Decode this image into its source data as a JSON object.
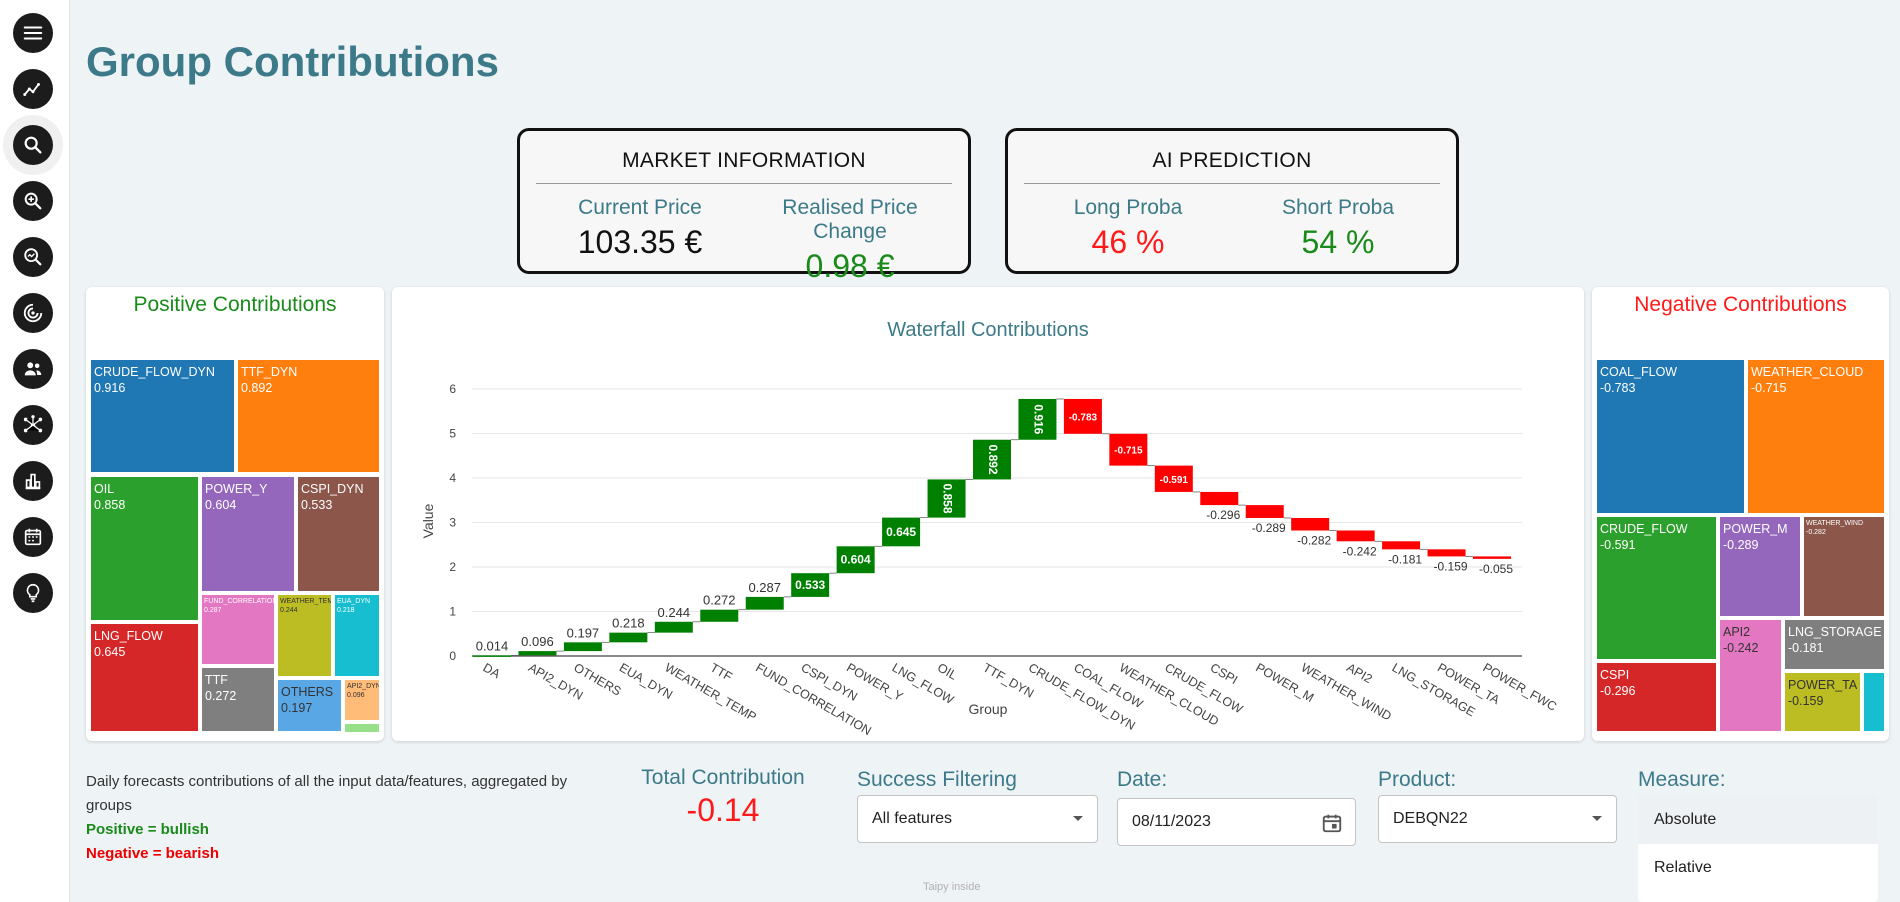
{
  "page": {
    "title": "Group Contributions",
    "footer": "Taipy inside"
  },
  "nav": [
    {
      "name": "menu-icon"
    },
    {
      "name": "trend-icon"
    },
    {
      "name": "search-icon"
    },
    {
      "name": "zoom-in-icon"
    },
    {
      "name": "analytics-search-icon"
    },
    {
      "name": "target-icon"
    },
    {
      "name": "users-icon"
    },
    {
      "name": "network-icon"
    },
    {
      "name": "bar-chart-icon"
    },
    {
      "name": "calendar-icon"
    },
    {
      "name": "lightbulb-icon"
    }
  ],
  "market": {
    "title": "MARKET INFORMATION",
    "current_label": "Current Price",
    "current_value": "103.35 €",
    "change_label": "Realised Price Change",
    "change_value": "0.98 €"
  },
  "ai": {
    "title": "AI PREDICTION",
    "long_label": "Long Proba",
    "long_value": "46 %",
    "short_label": "Short Proba",
    "short_value": "54 %"
  },
  "colors": {
    "positive": "#1a8a1a",
    "negative": "#ff1a1a",
    "accent": "#3c7a89",
    "green_bar": "#008000",
    "red_bar": "#ff0000"
  },
  "positive_panel": {
    "title": "Positive Contributions",
    "tiles": [
      {
        "label": "CRUDE_FLOW_DYN",
        "value": "0.916",
        "color": "#1f77b4"
      },
      {
        "label": "TTF_DYN",
        "value": "0.892",
        "color": "#ff7f0e"
      },
      {
        "label": "OIL",
        "value": "0.858",
        "color": "#2ca02c"
      },
      {
        "label": "POWER_Y",
        "value": "0.604",
        "color": "#9467bd"
      },
      {
        "label": "CSPI_DYN",
        "value": "0.533",
        "color": "#8c564b"
      },
      {
        "label": "LNG_FLOW",
        "value": "0.645",
        "color": "#d62728"
      },
      {
        "label": "FUND_CORRELATION",
        "value": "0.287",
        "color": "#e377c2"
      },
      {
        "label": "WEATHER_TEMP",
        "value": "0.244",
        "color": "#bcbd22"
      },
      {
        "label": "EUA_DYN",
        "value": "0.218",
        "color": "#17becf"
      },
      {
        "label": "TTF",
        "value": "0.272",
        "color": "#7f7f7f"
      },
      {
        "label": "OTHERS",
        "value": "0.197",
        "color": "#5aa7e6"
      },
      {
        "label": "API2_DYN",
        "value": "0.096",
        "color": "#ffbb78"
      },
      {
        "label": "DA",
        "value": "0.014",
        "color": "#98df8a"
      }
    ]
  },
  "negative_panel": {
    "title": "Negative Contributions",
    "tiles": [
      {
        "label": "COAL_FLOW",
        "value": "-0.783",
        "color": "#1f77b4"
      },
      {
        "label": "WEATHER_CLOUD",
        "value": "-0.715",
        "color": "#ff7f0e"
      },
      {
        "label": "CRUDE_FLOW",
        "value": "-0.591",
        "color": "#2ca02c"
      },
      {
        "label": "POWER_M",
        "value": "-0.289",
        "color": "#9467bd"
      },
      {
        "label": "WEATHER_WIND",
        "value": "-0.282",
        "color": "#8c564b"
      },
      {
        "label": "CSPI",
        "value": "-0.296",
        "color": "#d62728"
      },
      {
        "label": "API2",
        "value": "-0.242",
        "color": "#e377c2"
      },
      {
        "label": "LNG_STORAGE",
        "value": "-0.181",
        "color": "#7f7f7f"
      },
      {
        "label": "POWER_TA",
        "value": "-0.159",
        "color": "#bcbd22"
      },
      {
        "label": "POWER_FWC",
        "value": "-0.055",
        "color": "#17becf"
      }
    ]
  },
  "chart_data": {
    "type": "bar",
    "title": "Waterfall Contributions",
    "xlabel": "Group",
    "ylabel": "Value",
    "ylim": [
      0,
      6.3
    ],
    "yticks": [
      0,
      1,
      2,
      3,
      4,
      5,
      6
    ],
    "categories": [
      "DA",
      "API2_DYN",
      "OTHERS",
      "EUA_DYN",
      "WEATHER_TEMP",
      "TTF",
      "FUND_CORRELATION",
      "CSPI_DYN",
      "POWER_Y",
      "LNG_FLOW",
      "OIL",
      "TTF_DYN",
      "CRUDE_FLOW_DYN",
      "COAL_FLOW",
      "WEATHER_CLOUD",
      "CRUDE_FLOW",
      "CSPI",
      "POWER_M",
      "WEATHER_WIND",
      "API2",
      "LNG_STORAGE",
      "POWER_TA",
      "POWER_FWC"
    ],
    "values": [
      0.014,
      0.096,
      0.197,
      0.218,
      0.244,
      0.272,
      0.287,
      0.533,
      0.604,
      0.645,
      0.858,
      0.892,
      0.916,
      -0.783,
      -0.715,
      -0.591,
      -0.296,
      -0.289,
      -0.282,
      -0.242,
      -0.181,
      -0.159,
      -0.055
    ],
    "labels": [
      "0.014",
      "0.096",
      "0.197",
      "0.218",
      "0.244",
      "0.272",
      "0.287",
      "0.533",
      "0.604",
      "0.645",
      "0.858",
      "0.892",
      "0.916",
      "-0.783",
      "-0.715",
      "-0.591",
      "-0.296",
      "-0.289",
      "-0.282",
      "-0.242",
      "-0.181",
      "-0.159",
      "-0.055"
    ],
    "grid": true,
    "legend": false
  },
  "description": {
    "text": "Daily forecasts contributions of all the input data/features, aggregated by groups",
    "positive": "Positive = bullish",
    "negative": "Negative = bearish"
  },
  "total": {
    "label": "Total Contribution",
    "value": "-0.14"
  },
  "success": {
    "label": "Success Filtering",
    "selected": "All features"
  },
  "date": {
    "label": "Date:",
    "value": "08/11/2023"
  },
  "product": {
    "label": "Product:",
    "selected": "DEBQN22"
  },
  "measure": {
    "label": "Measure:",
    "options": [
      "Absolute",
      "Relative"
    ],
    "selected": "Absolute"
  }
}
